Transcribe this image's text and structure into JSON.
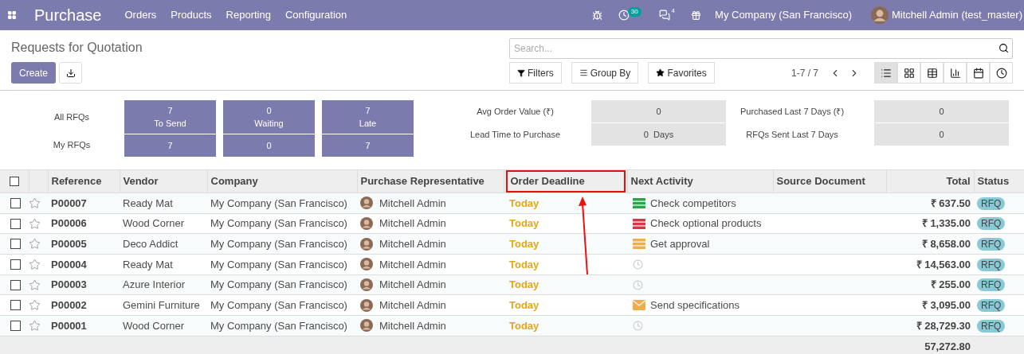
{
  "navbar": {
    "app": "Purchase",
    "menu": [
      "Orders",
      "Products",
      "Reporting",
      "Configuration"
    ],
    "activity_count": "30",
    "message_count": "4",
    "company": "My Company (San Francisco)",
    "user": "Mitchell Admin (test_master)"
  },
  "control_panel": {
    "title": "Requests for Quotation",
    "create": "Create",
    "search": {
      "placeholder": "Search..."
    },
    "filters": "Filters",
    "group_by": "Group By",
    "favorites": "Favorites",
    "pager": "1-7 / 7",
    "views": [
      {
        "kind": "list",
        "selected": true
      },
      {
        "kind": "kanban",
        "selected": false
      },
      {
        "kind": "pivot",
        "selected": false
      },
      {
        "kind": "graph",
        "selected": false
      },
      {
        "kind": "calendar",
        "selected": false
      },
      {
        "kind": "activity",
        "selected": false
      }
    ]
  },
  "dashboard": {
    "row_labels": [
      "All RFQs",
      "My RFQs"
    ],
    "all": [
      {
        "value": "7",
        "label": "To Send"
      },
      {
        "value": "0",
        "label": "Waiting"
      },
      {
        "value": "7",
        "label": "Late"
      }
    ],
    "my": [
      "7",
      "0",
      "7"
    ],
    "stats": [
      {
        "label": "Avg Order Value (₹)",
        "value": "0"
      },
      {
        "label": "Purchased Last 7 Days (₹)",
        "value": "0"
      },
      {
        "label": "Lead Time to Purchase",
        "value": "0  Days"
      },
      {
        "label": "RFQs Sent Last 7 Days",
        "value": "0"
      }
    ]
  },
  "table": {
    "select_all_checked": false,
    "columns": [
      {
        "label": "Reference",
        "highlighted": false
      },
      {
        "label": "Vendor",
        "highlighted": false
      },
      {
        "label": "Company",
        "highlighted": false
      },
      {
        "label": "Purchase Representative",
        "highlighted": false
      },
      {
        "label": "Order Deadline",
        "highlighted": true
      },
      {
        "label": "Next Activity",
        "highlighted": false
      },
      {
        "label": "Source Document",
        "highlighted": false
      },
      {
        "label": "Total",
        "highlighted": false
      },
      {
        "label": "Status",
        "highlighted": false
      }
    ],
    "rows": [
      {
        "checked": false,
        "reference": "P00007",
        "vendor": "Ready Mat",
        "company": "My Company (San Francisco)",
        "representative": "Mitchell Admin",
        "deadline": "Today",
        "activity": {
          "kind": "todo",
          "color": "#28a745",
          "text": "Check competitors"
        },
        "total": "₹ 637.50",
        "status": "RFQ"
      },
      {
        "checked": false,
        "reference": "P00006",
        "vendor": "Wood Corner",
        "company": "My Company (San Francisco)",
        "representative": "Mitchell Admin",
        "deadline": "Today",
        "activity": {
          "kind": "todo",
          "color": "#dc3545",
          "text": "Check optional products"
        },
        "total": "₹ 1,335.00",
        "status": "RFQ"
      },
      {
        "checked": false,
        "reference": "P00005",
        "vendor": "Deco Addict",
        "company": "My Company (San Francisco)",
        "representative": "Mitchell Admin",
        "deadline": "Today",
        "activity": {
          "kind": "todo",
          "color": "#f0ad4e",
          "text": "Get approval"
        },
        "total": "₹ 8,658.00",
        "status": "RFQ"
      },
      {
        "checked": false,
        "reference": "P00004",
        "vendor": "Ready Mat",
        "company": "My Company (San Francisco)",
        "representative": "Mitchell Admin",
        "deadline": "Today",
        "activity": {
          "kind": "none"
        },
        "total": "₹ 14,563.00",
        "status": "RFQ"
      },
      {
        "checked": false,
        "reference": "P00003",
        "vendor": "Azure Interior",
        "company": "My Company (San Francisco)",
        "representative": "Mitchell Admin",
        "deadline": "Today",
        "activity": {
          "kind": "none"
        },
        "total": "₹ 255.00",
        "status": "RFQ"
      },
      {
        "checked": false,
        "reference": "P00002",
        "vendor": "Gemini Furniture",
        "company": "My Company (San Francisco)",
        "representative": "Mitchell Admin",
        "deadline": "Today",
        "activity": {
          "kind": "email",
          "color": "#f0ad4e",
          "text": "Send specifications"
        },
        "total": "₹ 3,095.00",
        "status": "RFQ"
      },
      {
        "checked": false,
        "reference": "P00001",
        "vendor": "Wood Corner",
        "company": "My Company (San Francisco)",
        "representative": "Mitchell Admin",
        "deadline": "Today",
        "activity": {
          "kind": "none"
        },
        "total": "₹ 28,729.30",
        "status": "RFQ"
      }
    ],
    "sum_total": "57,272.80"
  }
}
